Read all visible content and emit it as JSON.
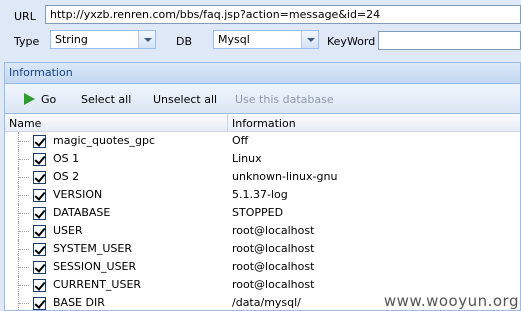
{
  "form": {
    "url_label": "URL",
    "url_value": "http://yxzb.renren.com/bbs/faq.jsp?action=message&id=24",
    "type_label": "Type",
    "type_value": "String",
    "db_label": "DB",
    "db_value": "Mysql",
    "keyword_label": "KeyWord",
    "keyword_value": ""
  },
  "panel": {
    "title": "Information",
    "toolbar": {
      "go": "Go",
      "select_all": "Select all",
      "unselect_all": "Unselect all",
      "use_db": "Use this database"
    },
    "columns": {
      "name": "Name",
      "info": "Information"
    },
    "rows": [
      {
        "name": "magic_quotes_gpc",
        "info": "Off",
        "checked": true
      },
      {
        "name": "OS 1",
        "info": "Linux",
        "checked": true
      },
      {
        "name": "OS 2",
        "info": "unknown-linux-gnu",
        "checked": true
      },
      {
        "name": "VERSION",
        "info": "5.1.37-log",
        "checked": true
      },
      {
        "name": "DATABASE",
        "info": "STOPPED",
        "checked": true
      },
      {
        "name": "USER",
        "info": "root@localhost",
        "checked": true
      },
      {
        "name": "SYSTEM_USER",
        "info": "root@localhost",
        "checked": true
      },
      {
        "name": "SESSION_USER",
        "info": "root@localhost",
        "checked": true
      },
      {
        "name": "CURRENT_USER",
        "info": "root@localhost",
        "checked": true
      },
      {
        "name": "BASE DIR",
        "info": "/data/mysql/",
        "checked": true
      }
    ]
  },
  "watermark": "www.wooyun.org"
}
